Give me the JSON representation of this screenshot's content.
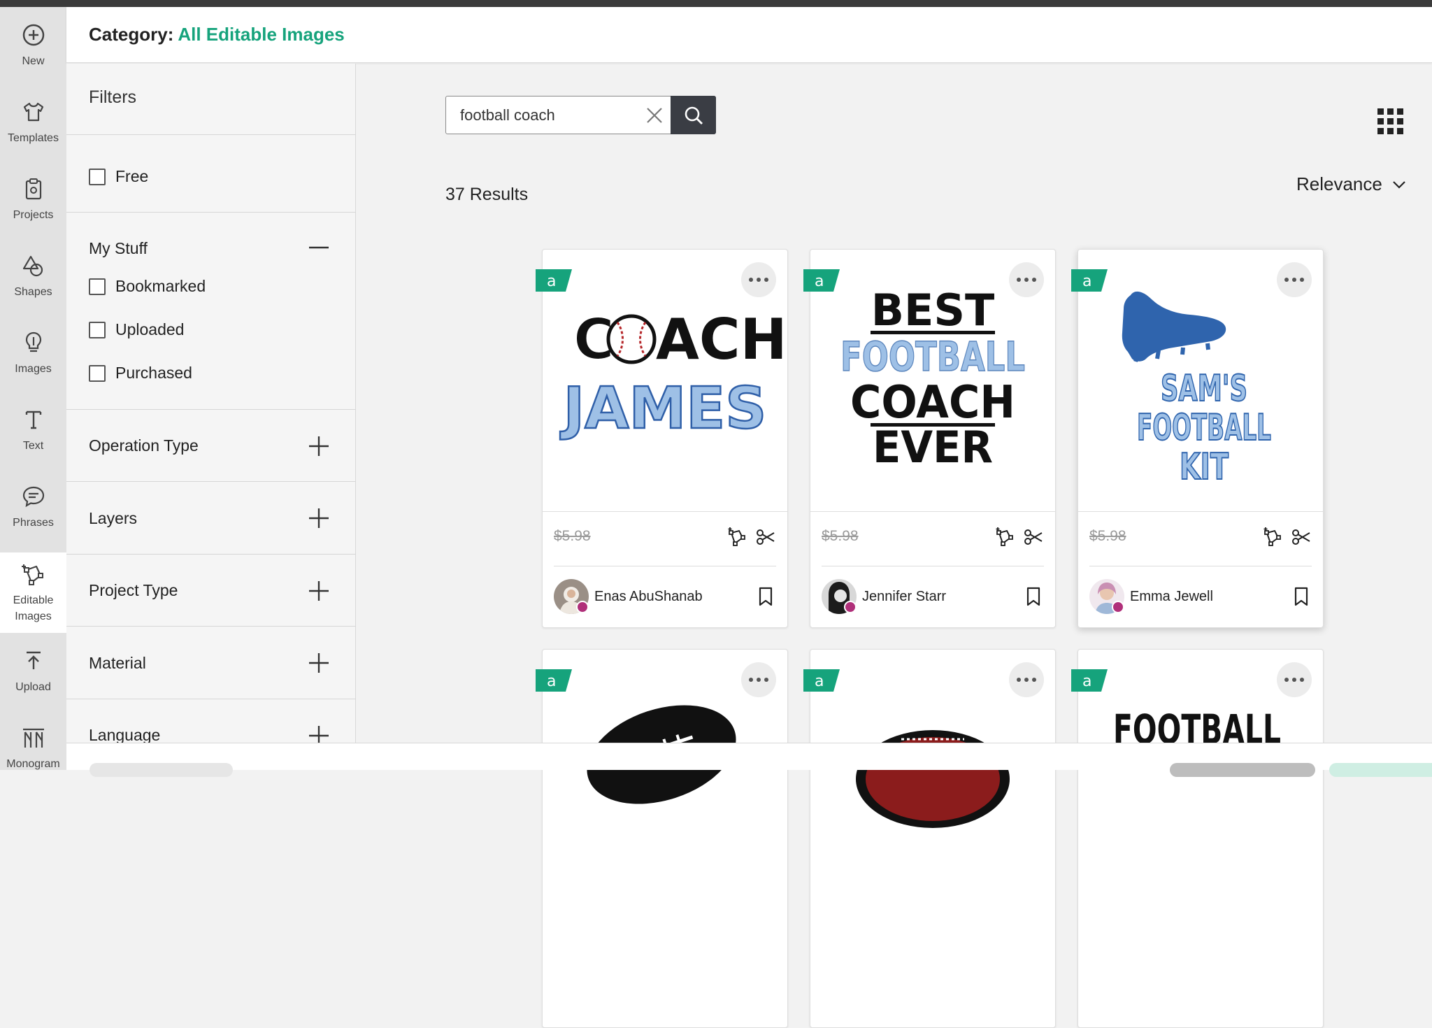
{
  "nav": {
    "items": [
      {
        "label": "New",
        "icon": "plus-circle-icon"
      },
      {
        "label": "Templates",
        "icon": "tshirt-icon"
      },
      {
        "label": "Projects",
        "icon": "clipboard-icon"
      },
      {
        "label": "Shapes",
        "icon": "shapes-icon"
      },
      {
        "label": "Images",
        "icon": "lightbulb-icon"
      },
      {
        "label": "Text",
        "icon": "text-icon"
      },
      {
        "label": "Phrases",
        "icon": "speech-bubble-icon"
      },
      {
        "label": "Editable\nImages",
        "icon": "editable-image-icon"
      },
      {
        "label": "Upload",
        "icon": "upload-icon"
      },
      {
        "label": "Monogram",
        "icon": "monogram-icon"
      }
    ],
    "active": "Editable Images"
  },
  "header": {
    "category_label": "Category:",
    "category_value": "All Editable Images"
  },
  "filters": {
    "title": "Filters",
    "free_label": "Free",
    "my_stuff": {
      "title": "My Stuff",
      "options": [
        "Bookmarked",
        "Uploaded",
        "Purchased"
      ]
    },
    "sections": [
      "Operation Type",
      "Layers",
      "Project Type",
      "Material",
      "Language"
    ]
  },
  "search": {
    "query": "football coach"
  },
  "results": {
    "count_label": "37 Results",
    "sort_label": "Relevance"
  },
  "cards": [
    {
      "art_lines": [
        "C",
        "ACH",
        "JAMES"
      ],
      "price": "$5.98",
      "author": "Enas AbuShanab"
    },
    {
      "art_lines": [
        "BEST",
        "FOOTBALL",
        "COACH",
        "EVER"
      ],
      "price": "$5.98",
      "author": "Jennifer Starr"
    },
    {
      "art_lines": [
        "SAM'S",
        "FOOTBALL",
        "KIT"
      ],
      "price": "$5.98",
      "author": "Emma Jewell"
    },
    {
      "art_lines": [],
      "price": "",
      "author": ""
    },
    {
      "art_lines": [],
      "price": "",
      "author": ""
    },
    {
      "art_lines": [
        "FOOTBALL"
      ],
      "price": "",
      "author": ""
    }
  ],
  "colors": {
    "accent": "#16a37c",
    "dark_button": "#3a3d44",
    "light_blue_text": "#8fb4dc",
    "shoe_blue": "#2f64ad"
  }
}
